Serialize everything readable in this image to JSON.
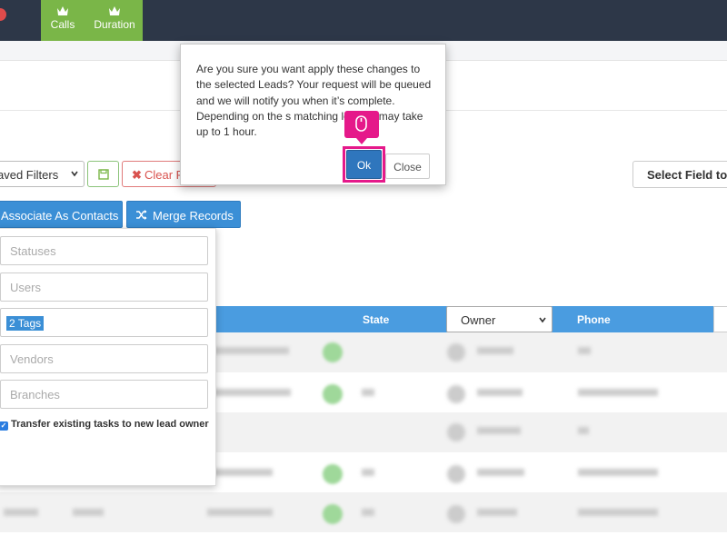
{
  "nav": {
    "tabs": [
      {
        "label": "Calls",
        "icon": "crown-icon"
      },
      {
        "label": "Duration",
        "icon": "crown-icon"
      }
    ],
    "accent": "#7ab648",
    "background": "#2d3748"
  },
  "filters": {
    "saved_filters_label": "aved Filters",
    "clear_label": "Clear F",
    "select_field_label": "Select Field to"
  },
  "actions": {
    "associate_label": "Associate As Contacts",
    "merge_label": "Merge Records"
  },
  "panel": {
    "statuses_placeholder": "Statuses",
    "users_placeholder": "Users",
    "tags_value": "2 Tags",
    "vendors_placeholder": "Vendors",
    "branches_placeholder": "Branches",
    "transfer_label": "Transfer existing tasks to new lead owner",
    "transfer_checked": true
  },
  "table": {
    "state_header": "State",
    "owner_selected": "Owner",
    "phone_header": "Phone"
  },
  "modal": {
    "message": "Are you sure you want apply these changes to the selected Leads? Your request will be queued and we will notify you when it’s complete. Depending on the s        matching leads it may take up to 1 hour.",
    "ok_label": "Ok",
    "close_label": "Close",
    "highlight_color": "#e5198a"
  }
}
